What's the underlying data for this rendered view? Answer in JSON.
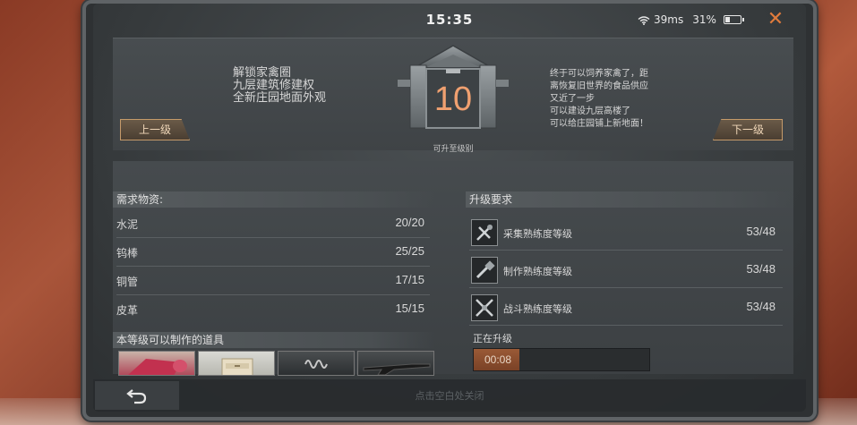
{
  "status": {
    "time": "15:35",
    "ping": "39ms",
    "battery": "31%",
    "battery_level": 0.31
  },
  "header": {
    "prev_label": "上一级",
    "next_label": "下一级",
    "unlocks": [
      "解锁家禽圈",
      "九层建筑修建权",
      "全新庄园地面外观"
    ],
    "description": [
      "终于可以饲养家禽了，距",
      "离恢复旧世界的食品供应",
      "又近了一步",
      "可以建设九层高楼了",
      "可以给庄园铺上新地面！"
    ],
    "level": "10",
    "level_label": "可升至级别"
  },
  "materials": {
    "title": "需求物资:",
    "items": [
      {
        "name": "水泥",
        "count": "20/20"
      },
      {
        "name": "钨棒",
        "count": "25/25"
      },
      {
        "name": "铜管",
        "count": "17/15"
      },
      {
        "name": "皮革",
        "count": "15/15"
      }
    ]
  },
  "craftable": {
    "title": "本等级可以制作的道具"
  },
  "requirements": {
    "title": "升级要求",
    "items": [
      {
        "name": "采集熟练度等级",
        "count": "53/48",
        "icon": "gather-icon"
      },
      {
        "name": "制作熟练度等级",
        "count": "53/48",
        "icon": "craft-icon"
      },
      {
        "name": "战斗熟练度等级",
        "count": "53/48",
        "icon": "combat-icon"
      }
    ]
  },
  "upgrading": {
    "label": "正在升级",
    "time": "00:08",
    "progress": 0.26
  },
  "footer": {
    "close_hint": "点击空白处关闭"
  },
  "colors": {
    "accent": "#e07b3c",
    "level": "#f0a070",
    "progress": "#9a5a36"
  }
}
